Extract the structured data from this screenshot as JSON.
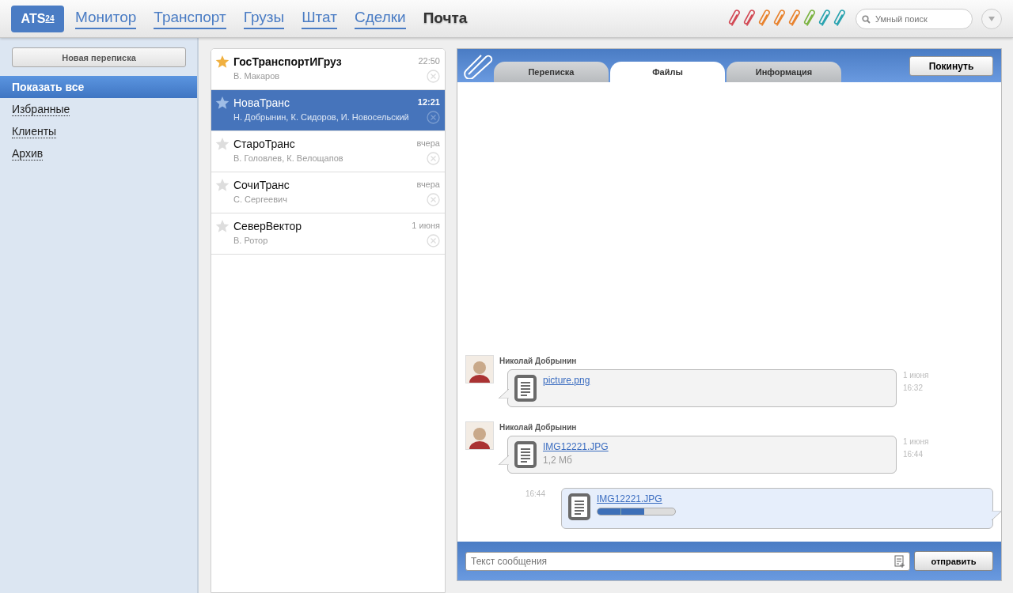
{
  "logo": {
    "text": "ATS",
    "sup": "24"
  },
  "nav": [
    {
      "label": "Монитор",
      "selected": false
    },
    {
      "label": "Транспорт",
      "selected": false
    },
    {
      "label": "Грузы",
      "selected": false
    },
    {
      "label": "Штат",
      "selected": false
    },
    {
      "label": "Сделки",
      "selected": false
    },
    {
      "label": "Почта",
      "selected": true
    }
  ],
  "clips": [
    {
      "color": "#d24a55"
    },
    {
      "color": "#d24a55"
    },
    {
      "color": "#e8822e"
    },
    {
      "color": "#e8822e"
    },
    {
      "color": "#e8822e"
    },
    {
      "color": "#7cb342"
    },
    {
      "color": "#2aa3b0"
    },
    {
      "color": "#2aa3b0"
    }
  ],
  "search": {
    "placeholder": "Умный поиск"
  },
  "sidebar": {
    "new_button": "Новая переписка",
    "items": [
      {
        "label": "Показать все",
        "selected": true
      },
      {
        "label": "Избранные",
        "selected": false
      },
      {
        "label": "Клиенты",
        "selected": false
      },
      {
        "label": "Архив",
        "selected": false
      }
    ]
  },
  "conversations": [
    {
      "title": "ГосТранспортИГруз",
      "people": "В. Макаров",
      "time": "22:50",
      "starred": true,
      "unread": true,
      "selected": false
    },
    {
      "title": "НоваТранс",
      "people": "Н. Добрынин, К. Сидоров, И. Новосельский",
      "time": "12:21",
      "starred": false,
      "unread": false,
      "selected": true
    },
    {
      "title": "СтароТранс",
      "people": "В. Головлев, К. Велощапов",
      "time": "вчера",
      "starred": false,
      "unread": false,
      "selected": false
    },
    {
      "title": "СочиТранс",
      "people": "С. Сергеевич",
      "time": "вчера",
      "starred": false,
      "unread": false,
      "selected": false
    },
    {
      "title": "СеверВектор",
      "people": "В. Ротор",
      "time": "1 июня",
      "starred": false,
      "unread": false,
      "selected": false
    }
  ],
  "tabs": [
    {
      "label": "Переписка",
      "selected": false
    },
    {
      "label": "Файлы",
      "selected": true
    },
    {
      "label": "Информация",
      "selected": false
    }
  ],
  "leave_button": "Покинуть",
  "messages": [
    {
      "kind": "incoming",
      "author": "Николай Добрынин",
      "file": "picture.png",
      "date": "1 июня",
      "time": "16:32"
    },
    {
      "kind": "incoming",
      "author": "Николай Добрынин",
      "file": "IMG12221.JPG",
      "size": "1,2 Мб",
      "date": "1 июня",
      "time": "16:44"
    },
    {
      "kind": "outgoing",
      "file": "IMG12221.JPG",
      "time": "16:44",
      "level": 0.6
    }
  ],
  "composer": {
    "placeholder": "Текст сообщения",
    "send": "отправить"
  }
}
